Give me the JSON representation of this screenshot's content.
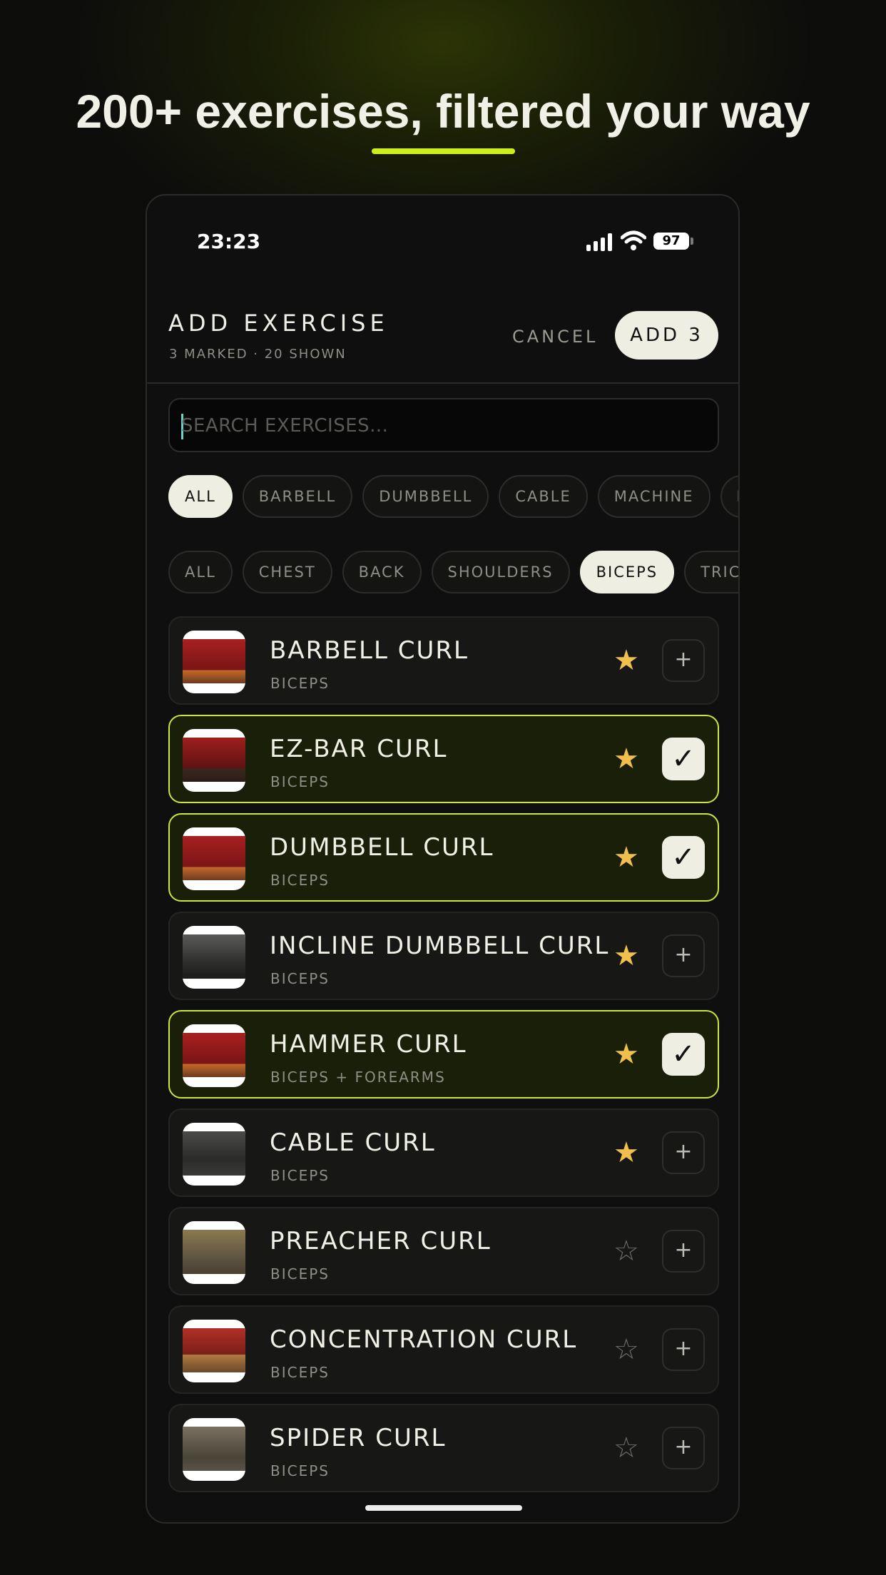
{
  "headline": "200+ exercises, filtered your way",
  "accent_color": "#cdef1a",
  "status_bar": {
    "time": "23:23",
    "battery": "97",
    "icons": [
      "signal-icon",
      "wifi-icon",
      "battery-icon"
    ]
  },
  "header": {
    "title": "ADD EXERCISE",
    "subtitle": "3 MARKED · 20 SHOWN",
    "cancel_label": "CANCEL",
    "add_label": "ADD 3"
  },
  "search": {
    "placeholder": "SEARCH EXERCISES..."
  },
  "equipment_filters": [
    {
      "label": "ALL",
      "active": true
    },
    {
      "label": "BARBELL",
      "active": false
    },
    {
      "label": "DUMBBELL",
      "active": false
    },
    {
      "label": "CABLE",
      "active": false
    },
    {
      "label": "MACHINE",
      "active": false
    },
    {
      "label": "BODYWEIGHT",
      "active": false
    }
  ],
  "muscle_filters": [
    {
      "label": "ALL",
      "active": false
    },
    {
      "label": "CHEST",
      "active": false
    },
    {
      "label": "BACK",
      "active": false
    },
    {
      "label": "SHOULDERS",
      "active": false
    },
    {
      "label": "BICEPS",
      "active": true
    },
    {
      "label": "TRICEPS",
      "active": false
    }
  ],
  "exercises": [
    {
      "name": "BARBELL CURL",
      "muscle": "BICEPS",
      "starred": true,
      "selected": false
    },
    {
      "name": "EZ-BAR CURL",
      "muscle": "BICEPS",
      "starred": true,
      "selected": true
    },
    {
      "name": "DUMBBELL CURL",
      "muscle": "BICEPS",
      "starred": true,
      "selected": true
    },
    {
      "name": "INCLINE DUMBBELL CURL",
      "muscle": "BICEPS",
      "starred": true,
      "selected": false
    },
    {
      "name": "HAMMER CURL",
      "muscle": "BICEPS + FOREARMS",
      "starred": true,
      "selected": true
    },
    {
      "name": "CABLE CURL",
      "muscle": "BICEPS",
      "starred": true,
      "selected": false
    },
    {
      "name": "PREACHER CURL",
      "muscle": "BICEPS",
      "starred": false,
      "selected": false
    },
    {
      "name": "CONCENTRATION CURL",
      "muscle": "BICEPS",
      "starred": false,
      "selected": false
    },
    {
      "name": "SPIDER CURL",
      "muscle": "BICEPS",
      "starred": false,
      "selected": false
    }
  ],
  "glyphs": {
    "star_on": "★",
    "star_off": "☆",
    "plus": "+",
    "check": "✓"
  }
}
